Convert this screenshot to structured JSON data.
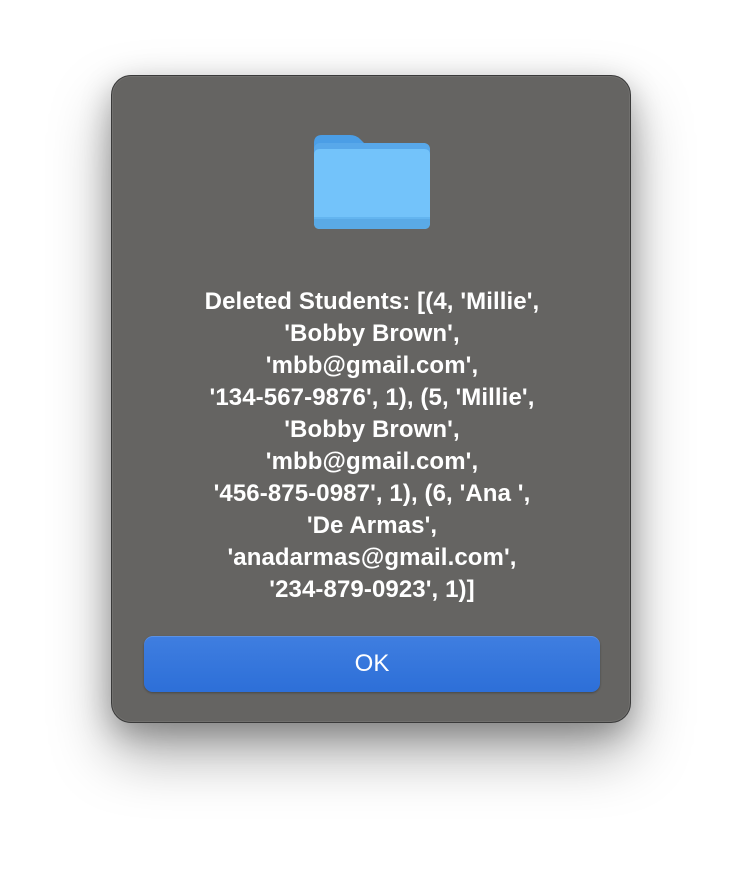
{
  "dialog": {
    "icon": "folder-icon",
    "message": "Deleted Students: [(4, 'Millie',\n'Bobby Brown',\n'mbb@gmail.com',\n'134-567-9876', 1), (5, 'Millie',\n'Bobby Brown',\n'mbb@gmail.com',\n'456-875-0987', 1), (6, 'Ana ',\n'De Armas',\n'anadarmas@gmail.com',\n'234-879-0923', 1)]",
    "ok_label": "OK"
  },
  "colors": {
    "panel": "#656462",
    "button": "#3475dc",
    "folder": "#6cbef3"
  }
}
